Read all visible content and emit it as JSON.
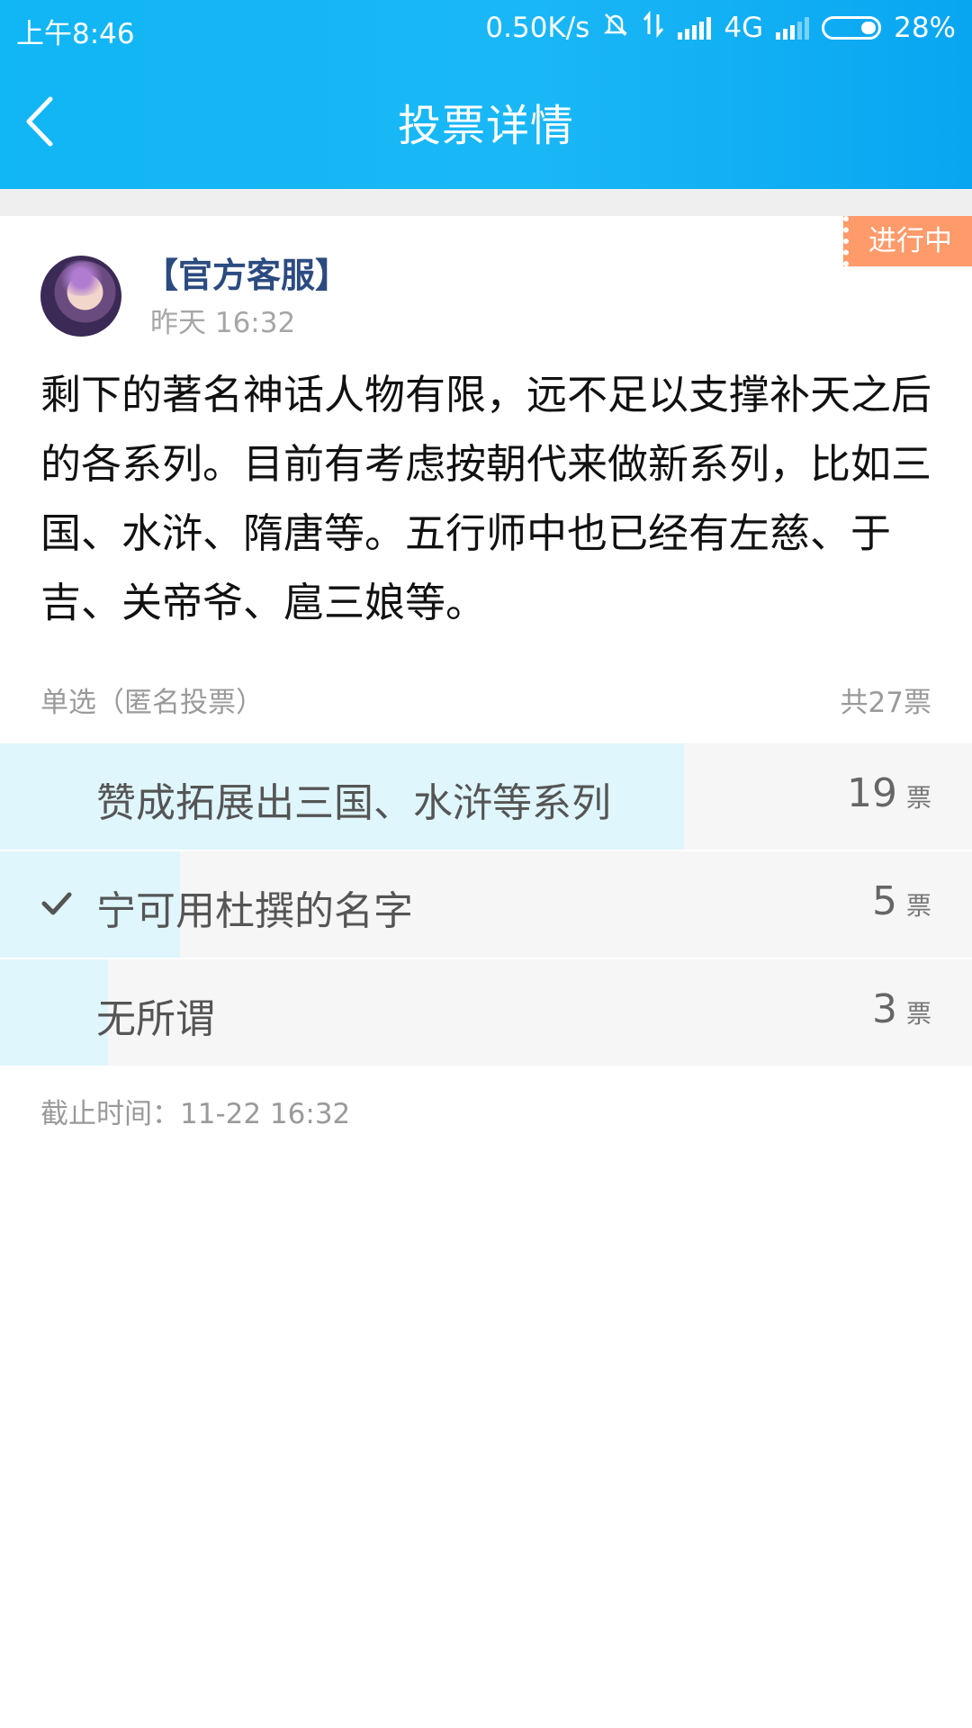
{
  "status_bar": {
    "time": "上午8:46",
    "speed": "0.50K/s",
    "network": "4G",
    "battery": "28%"
  },
  "nav": {
    "title": "投票详情"
  },
  "post": {
    "status_tag": "进行中",
    "author": "【官方客服】",
    "time": "昨天 16:32",
    "content": "剩下的著名神话人物有限，远不足以支撑补天之后的各系列。目前有考虑按朝代来做新系列，比如三国、水浒、隋唐等。五行师中也已经有左慈、于吉、关帝爷、扈三娘等。"
  },
  "vote": {
    "meta": "单选（匿名投票）",
    "total": "共27票",
    "unit": "票",
    "options": [
      {
        "label": "赞成拓展出三国、水浒等系列",
        "count": "19",
        "fraction": 0.7037,
        "selected": false
      },
      {
        "label": "宁可用杜撰的名字",
        "count": "5",
        "fraction": 0.1852,
        "selected": true
      },
      {
        "label": "无所谓",
        "count": "3",
        "fraction": 0.1111,
        "selected": false
      }
    ],
    "deadline": "截止时间：11-22 16:32"
  },
  "colors": {
    "header": "#11b6f4",
    "tag": "#ff9a6b",
    "author": "#2b4b80",
    "bar": "#dff6fc"
  }
}
